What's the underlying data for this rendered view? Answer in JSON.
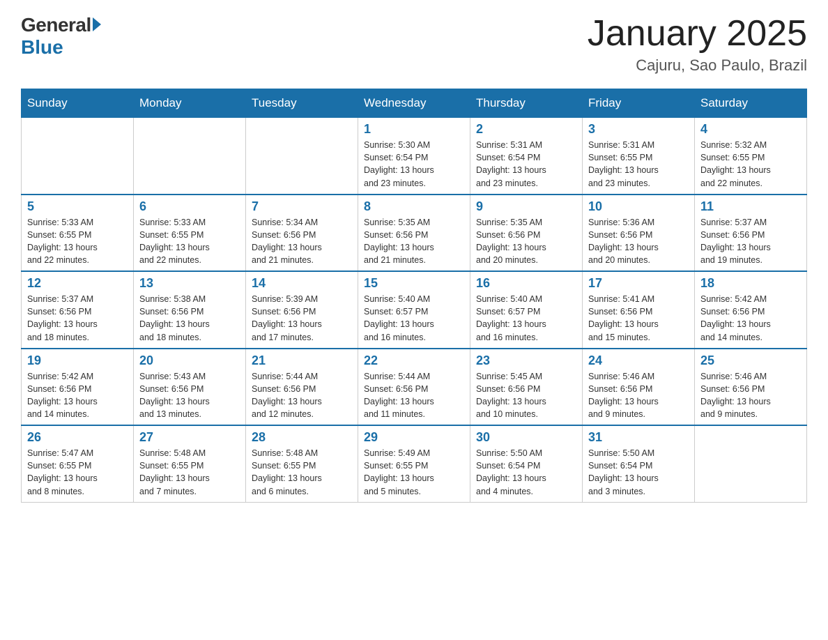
{
  "header": {
    "logo_general": "General",
    "logo_blue": "Blue",
    "title": "January 2025",
    "subtitle": "Cajuru, Sao Paulo, Brazil"
  },
  "days_of_week": [
    "Sunday",
    "Monday",
    "Tuesday",
    "Wednesday",
    "Thursday",
    "Friday",
    "Saturday"
  ],
  "weeks": [
    [
      {
        "day": "",
        "info": ""
      },
      {
        "day": "",
        "info": ""
      },
      {
        "day": "",
        "info": ""
      },
      {
        "day": "1",
        "info": "Sunrise: 5:30 AM\nSunset: 6:54 PM\nDaylight: 13 hours\nand 23 minutes."
      },
      {
        "day": "2",
        "info": "Sunrise: 5:31 AM\nSunset: 6:54 PM\nDaylight: 13 hours\nand 23 minutes."
      },
      {
        "day": "3",
        "info": "Sunrise: 5:31 AM\nSunset: 6:55 PM\nDaylight: 13 hours\nand 23 minutes."
      },
      {
        "day": "4",
        "info": "Sunrise: 5:32 AM\nSunset: 6:55 PM\nDaylight: 13 hours\nand 22 minutes."
      }
    ],
    [
      {
        "day": "5",
        "info": "Sunrise: 5:33 AM\nSunset: 6:55 PM\nDaylight: 13 hours\nand 22 minutes."
      },
      {
        "day": "6",
        "info": "Sunrise: 5:33 AM\nSunset: 6:55 PM\nDaylight: 13 hours\nand 22 minutes."
      },
      {
        "day": "7",
        "info": "Sunrise: 5:34 AM\nSunset: 6:56 PM\nDaylight: 13 hours\nand 21 minutes."
      },
      {
        "day": "8",
        "info": "Sunrise: 5:35 AM\nSunset: 6:56 PM\nDaylight: 13 hours\nand 21 minutes."
      },
      {
        "day": "9",
        "info": "Sunrise: 5:35 AM\nSunset: 6:56 PM\nDaylight: 13 hours\nand 20 minutes."
      },
      {
        "day": "10",
        "info": "Sunrise: 5:36 AM\nSunset: 6:56 PM\nDaylight: 13 hours\nand 20 minutes."
      },
      {
        "day": "11",
        "info": "Sunrise: 5:37 AM\nSunset: 6:56 PM\nDaylight: 13 hours\nand 19 minutes."
      }
    ],
    [
      {
        "day": "12",
        "info": "Sunrise: 5:37 AM\nSunset: 6:56 PM\nDaylight: 13 hours\nand 18 minutes."
      },
      {
        "day": "13",
        "info": "Sunrise: 5:38 AM\nSunset: 6:56 PM\nDaylight: 13 hours\nand 18 minutes."
      },
      {
        "day": "14",
        "info": "Sunrise: 5:39 AM\nSunset: 6:56 PM\nDaylight: 13 hours\nand 17 minutes."
      },
      {
        "day": "15",
        "info": "Sunrise: 5:40 AM\nSunset: 6:57 PM\nDaylight: 13 hours\nand 16 minutes."
      },
      {
        "day": "16",
        "info": "Sunrise: 5:40 AM\nSunset: 6:57 PM\nDaylight: 13 hours\nand 16 minutes."
      },
      {
        "day": "17",
        "info": "Sunrise: 5:41 AM\nSunset: 6:56 PM\nDaylight: 13 hours\nand 15 minutes."
      },
      {
        "day": "18",
        "info": "Sunrise: 5:42 AM\nSunset: 6:56 PM\nDaylight: 13 hours\nand 14 minutes."
      }
    ],
    [
      {
        "day": "19",
        "info": "Sunrise: 5:42 AM\nSunset: 6:56 PM\nDaylight: 13 hours\nand 14 minutes."
      },
      {
        "day": "20",
        "info": "Sunrise: 5:43 AM\nSunset: 6:56 PM\nDaylight: 13 hours\nand 13 minutes."
      },
      {
        "day": "21",
        "info": "Sunrise: 5:44 AM\nSunset: 6:56 PM\nDaylight: 13 hours\nand 12 minutes."
      },
      {
        "day": "22",
        "info": "Sunrise: 5:44 AM\nSunset: 6:56 PM\nDaylight: 13 hours\nand 11 minutes."
      },
      {
        "day": "23",
        "info": "Sunrise: 5:45 AM\nSunset: 6:56 PM\nDaylight: 13 hours\nand 10 minutes."
      },
      {
        "day": "24",
        "info": "Sunrise: 5:46 AM\nSunset: 6:56 PM\nDaylight: 13 hours\nand 9 minutes."
      },
      {
        "day": "25",
        "info": "Sunrise: 5:46 AM\nSunset: 6:56 PM\nDaylight: 13 hours\nand 9 minutes."
      }
    ],
    [
      {
        "day": "26",
        "info": "Sunrise: 5:47 AM\nSunset: 6:55 PM\nDaylight: 13 hours\nand 8 minutes."
      },
      {
        "day": "27",
        "info": "Sunrise: 5:48 AM\nSunset: 6:55 PM\nDaylight: 13 hours\nand 7 minutes."
      },
      {
        "day": "28",
        "info": "Sunrise: 5:48 AM\nSunset: 6:55 PM\nDaylight: 13 hours\nand 6 minutes."
      },
      {
        "day": "29",
        "info": "Sunrise: 5:49 AM\nSunset: 6:55 PM\nDaylight: 13 hours\nand 5 minutes."
      },
      {
        "day": "30",
        "info": "Sunrise: 5:50 AM\nSunset: 6:54 PM\nDaylight: 13 hours\nand 4 minutes."
      },
      {
        "day": "31",
        "info": "Sunrise: 5:50 AM\nSunset: 6:54 PM\nDaylight: 13 hours\nand 3 minutes."
      },
      {
        "day": "",
        "info": ""
      }
    ]
  ]
}
